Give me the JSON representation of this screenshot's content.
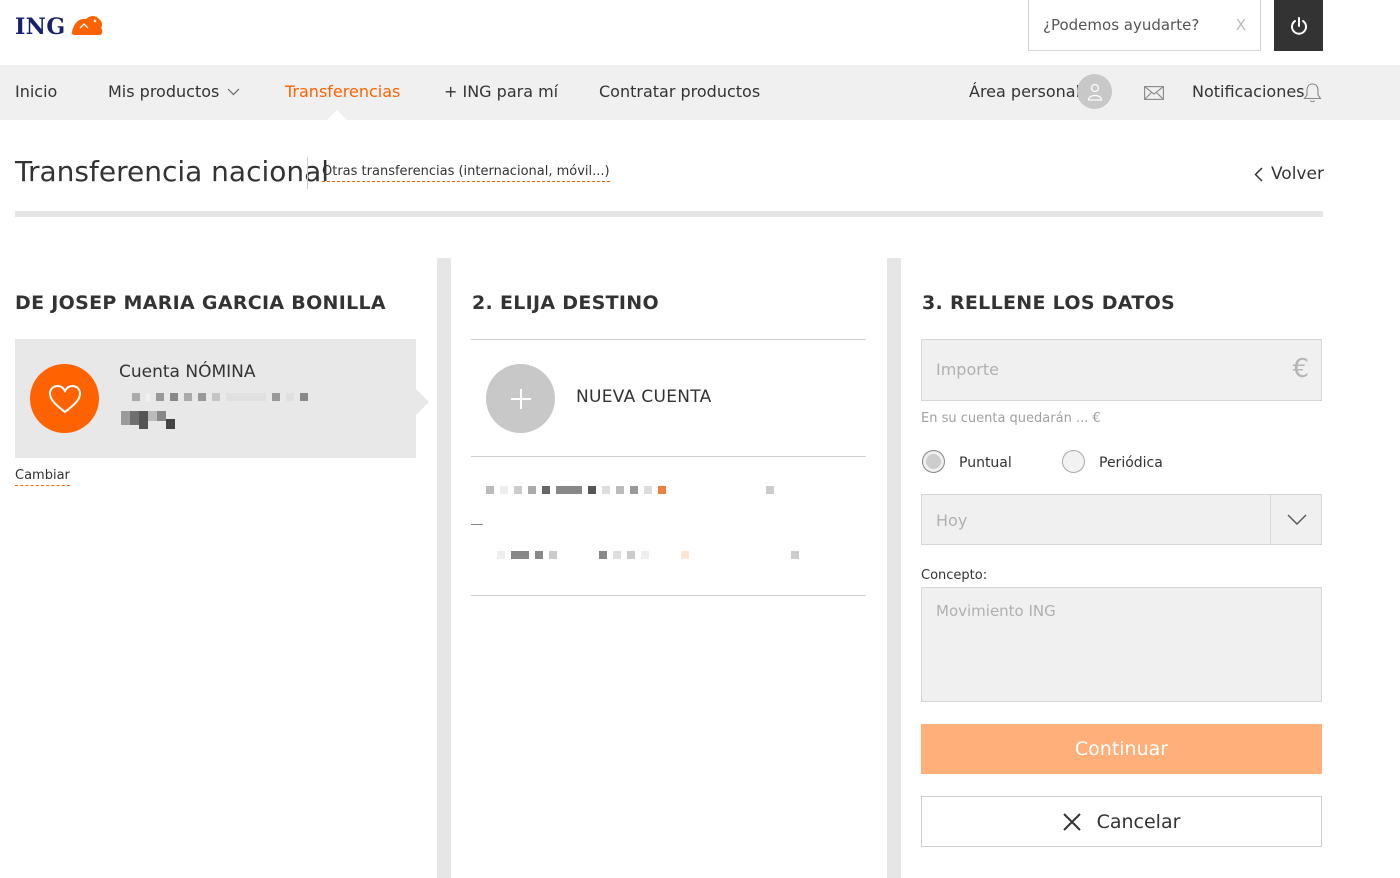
{
  "header": {
    "logo_text": "ING",
    "help_placeholder": "¿Podemos ayudarte?",
    "help_close": "X"
  },
  "nav": {
    "items": [
      {
        "label": "Inicio"
      },
      {
        "label": "Mis productos"
      },
      {
        "label": "Transferencias",
        "active": true
      },
      {
        "label": "+ ING para mí"
      },
      {
        "label": "Contratar productos"
      }
    ],
    "personal_area": "Área personal",
    "notifications": "Notificaciones"
  },
  "page": {
    "title": "Transferencia nacional",
    "other_transfers": "Otras transferencias (internacional, móvil...)",
    "back": "Volver"
  },
  "origin": {
    "heading": "DE JOSEP MARIA GARCIA BONILLA",
    "account_name": "Cuenta NÓMINA",
    "change": "Cambiar"
  },
  "destination": {
    "heading": "2. ELIJA DESTINO",
    "new_account": "NUEVA CUENTA"
  },
  "details": {
    "heading": "3. RELLENE LOS DATOS",
    "amount_placeholder": "Importe",
    "currency": "€",
    "balance_note": "En su cuenta quedarán ... €",
    "frequency": {
      "once": "Puntual",
      "periodic": "Periódica",
      "selected": "Puntual"
    },
    "date_value": "Hoy",
    "concept_label": "Concepto:",
    "concept_placeholder": "Movimiento ING",
    "continue": "Continuar",
    "cancel": "Cancelar"
  },
  "colors": {
    "brand_orange": "#ff6200",
    "brand_navy": "#16206b",
    "continue_disabled": "#ffb07a",
    "nav_bg": "#f0f0f0"
  }
}
